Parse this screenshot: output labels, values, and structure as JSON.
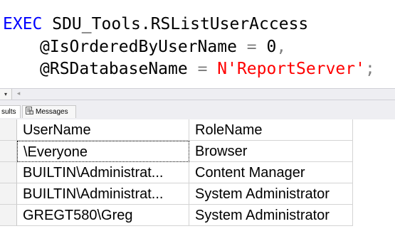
{
  "editor": {
    "line1": {
      "kw": "EXEC",
      "rest": " SDU_Tools.RSListUserAccess"
    },
    "line2": {
      "param": "@IsOrderedByUserName",
      "eq": " = ",
      "value": "0",
      "punct": ","
    },
    "line3": {
      "param": "@RSDatabaseName",
      "eq": " = ",
      "value": "N'ReportServer'",
      "punct": ";"
    }
  },
  "scrollstrip": {
    "zoom_dropdown_glyph": "▾",
    "scroll_left_glyph": "◂"
  },
  "tabs": [
    {
      "label": "sults",
      "icon": "grid-icon"
    },
    {
      "label": "Messages",
      "icon": "messages-icon"
    }
  ],
  "grid": {
    "columns": [
      "UserName",
      "RoleName"
    ],
    "rows": [
      [
        "\\Everyone",
        "Browser"
      ],
      [
        "BUILTIN\\Administrat...",
        "Content Manager"
      ],
      [
        "BUILTIN\\Administrat...",
        "System Administrator"
      ],
      [
        "GREGT580\\Greg",
        "System Administrator"
      ]
    ]
  },
  "colors": {
    "keyword": "#0000ff",
    "string": "#ff0000",
    "operator": "#808080",
    "gridline": "#d4d4d4"
  }
}
